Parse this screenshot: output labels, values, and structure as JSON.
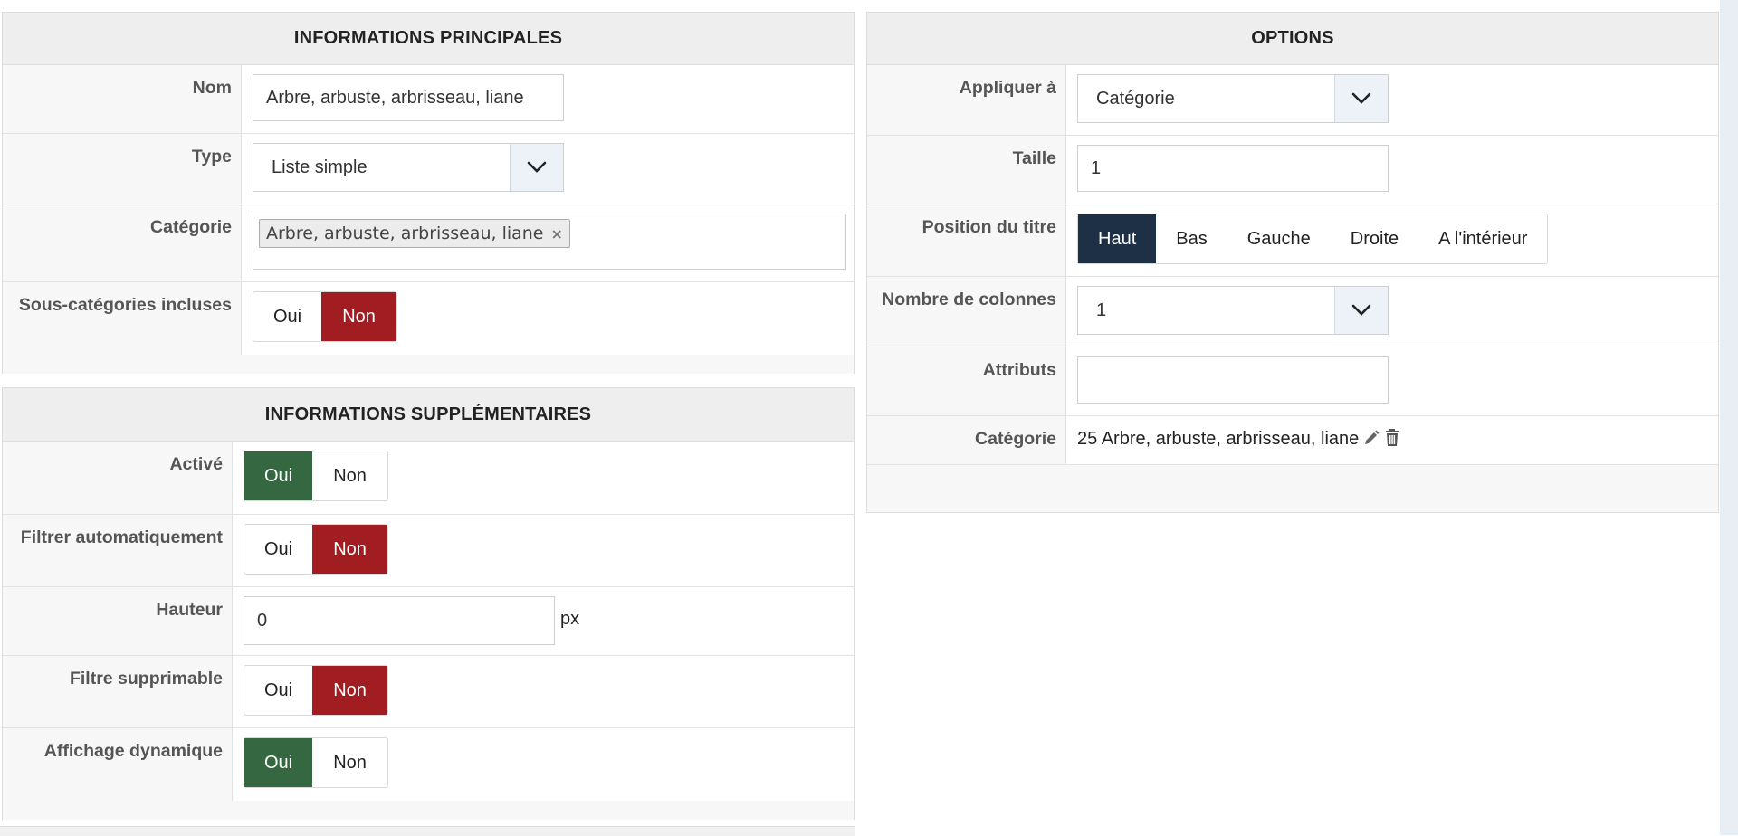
{
  "main_info": {
    "title": "INFORMATIONS PRINCIPALES",
    "nom": {
      "label": "Nom",
      "value": "Arbre, arbuste, arbrisseau, liane"
    },
    "type": {
      "label": "Type",
      "value": "Liste simple"
    },
    "categorie": {
      "label": "Catégorie",
      "tag": "Arbre, arbuste, arbrisseau, liane",
      "tag_remove": "×"
    },
    "sous_categories": {
      "label": "Sous-catégories incluses",
      "oui": "Oui",
      "non": "Non",
      "selected": "Non"
    }
  },
  "extra_info": {
    "title": "INFORMATIONS SUPPLÉMENTAIRES",
    "active": {
      "label": "Activé",
      "oui": "Oui",
      "non": "Non",
      "selected": "Oui"
    },
    "filtrer_auto": {
      "label": "Filtrer automatiquement",
      "oui": "Oui",
      "non": "Non",
      "selected": "Non"
    },
    "hauteur": {
      "label": "Hauteur",
      "value": "0",
      "unit": "px"
    },
    "filtre_supprimable": {
      "label": "Filtre supprimable",
      "oui": "Oui",
      "non": "Non",
      "selected": "Non"
    },
    "affichage_dynamique": {
      "label": "Affichage dynamique",
      "oui": "Oui",
      "non": "Non",
      "selected": "Oui"
    }
  },
  "options": {
    "title": "OPTIONS",
    "appliquer": {
      "label": "Appliquer à",
      "value": "Catégorie"
    },
    "taille": {
      "label": "Taille",
      "value": "1"
    },
    "position_titre": {
      "label": "Position du titre",
      "choices": [
        "Haut",
        "Bas",
        "Gauche",
        "Droite",
        "A l'intérieur"
      ],
      "selected": "Haut"
    },
    "nb_colonnes": {
      "label": "Nombre de colonnes",
      "value": "1"
    },
    "attributs": {
      "label": "Attributs",
      "value": ""
    },
    "categorie": {
      "label": "Catégorie",
      "value": "25 Arbre, arbuste, arbrisseau, liane"
    }
  },
  "colors": {
    "active_green": "#356841",
    "active_red": "#a11d21",
    "active_navy": "#1d3045",
    "select_arrow_bg": "#edf2f8"
  },
  "icons": [
    "chevron-down-icon",
    "remove-tag-icon",
    "pencil-icon",
    "trash-icon"
  ]
}
